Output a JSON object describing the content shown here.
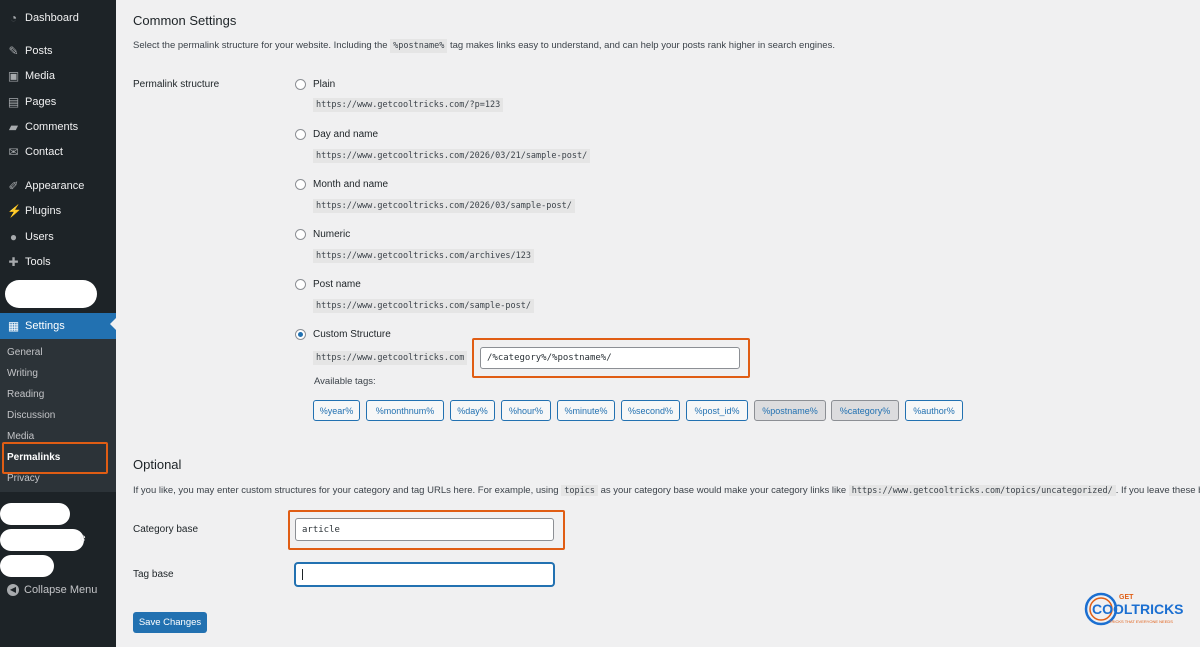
{
  "sidebar": {
    "items": [
      {
        "label": "Dashboard",
        "icon": "dashboard-icon",
        "glyph": "◔"
      },
      {
        "label": "Posts",
        "icon": "pushpin-icon",
        "glyph": "✎"
      },
      {
        "label": "Media",
        "icon": "media-icon",
        "glyph": "▣"
      },
      {
        "label": "Pages",
        "icon": "pages-icon",
        "glyph": "▤"
      },
      {
        "label": "Comments",
        "icon": "comments-icon",
        "glyph": "▰"
      },
      {
        "label": "Contact",
        "icon": "envelope-icon",
        "glyph": "✉"
      },
      {
        "label": "Appearance",
        "icon": "paintbrush-icon",
        "glyph": "✐"
      },
      {
        "label": "Plugins",
        "icon": "plugin-icon",
        "glyph": "⚡"
      },
      {
        "label": "Users",
        "icon": "users-icon",
        "glyph": "●"
      },
      {
        "label": "Tools",
        "icon": "wrench-icon",
        "glyph": "✚"
      },
      {
        "label": "Settings",
        "icon": "settings-icon",
        "glyph": "▦"
      }
    ],
    "submenu": [
      "General",
      "Writing",
      "Reading",
      "Discussion",
      "Media",
      "Permalinks",
      "Privacy"
    ],
    "partial_label": "e",
    "collapse_label": "Collapse Menu",
    "collapse_icon": "collapse-arrow-icon"
  },
  "common": {
    "heading": "Common Settings",
    "desc_before": "Select the permalink structure for your website. Including the",
    "desc_code": "%postname%",
    "desc_after": "tag makes links easy to understand, and can help your posts rank higher in search engines.",
    "structure_label": "Permalink structure",
    "options": [
      {
        "label": "Plain",
        "example": "https://www.getcooltricks.com/?p=123",
        "checked": false
      },
      {
        "label": "Day and name",
        "example": "https://www.getcooltricks.com/2026/03/21/sample-post/",
        "checked": false
      },
      {
        "label": "Month and name",
        "example": "https://www.getcooltricks.com/2026/03/sample-post/",
        "checked": false
      },
      {
        "label": "Numeric",
        "example": "https://www.getcooltricks.com/archives/123",
        "checked": false
      },
      {
        "label": "Post name",
        "example": "https://www.getcooltricks.com/sample-post/",
        "checked": false
      },
      {
        "label": "Custom Structure",
        "checked": true
      }
    ],
    "custom_prefix": "https://www.getcooltricks.com",
    "custom_value": "/%category%/%postname%/",
    "available_tags_label": "Available tags:",
    "tags": [
      "%year%",
      "%monthnum%",
      "%day%",
      "%hour%",
      "%minute%",
      "%second%",
      "%post_id%",
      "%postname%",
      "%category%",
      "%author%"
    ],
    "active_tags": [
      "%postname%",
      "%category%"
    ]
  },
  "optional": {
    "heading": "Optional",
    "desc_before": "If you like, you may enter custom structures for your category and tag URLs here. For example, using",
    "desc_code1": "topics",
    "desc_middle": "as your category base would make your category links like",
    "desc_code2": "https://www.getcooltricks.com/topics/uncategorized/",
    "desc_after": ". If you leave these blank",
    "category_label": "Category base",
    "category_value": "article",
    "tag_label": "Tag base",
    "tag_value": ""
  },
  "save_label": "Save Changes",
  "logo": {
    "top": "GET",
    "main": "COOLTRICKS",
    "tagline": "TRICKS THAT EVERYONE NEEDS",
    "color": "#1b6fd1",
    "accent": "#e05d14"
  },
  "colors": {
    "accent": "#2271b1",
    "highlight": "#e05d14",
    "sidebar": "#1d2327"
  }
}
